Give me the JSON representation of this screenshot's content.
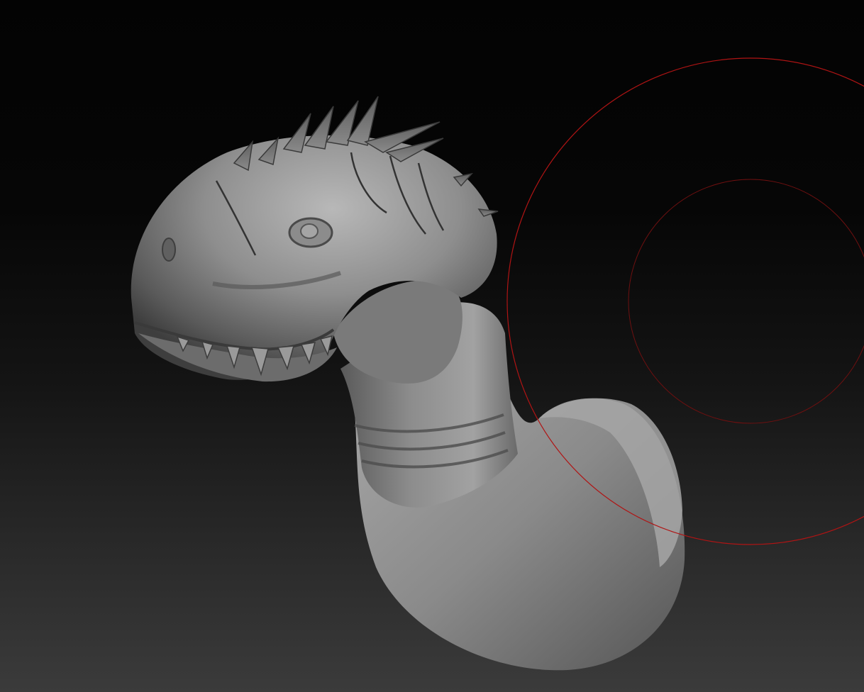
{
  "app": {
    "view": "3d-sculpt-viewport"
  },
  "viewport": {
    "background_top": "#030303",
    "background_bottom": "#3b3b3b",
    "model": {
      "subject": "serpent-creature-head-and-neck",
      "material_color": "#8c8c8c"
    },
    "brush_cursor": {
      "color": "#b01414",
      "rings": [
        "outer-draw-size",
        "inner-focal-shift"
      ]
    }
  }
}
